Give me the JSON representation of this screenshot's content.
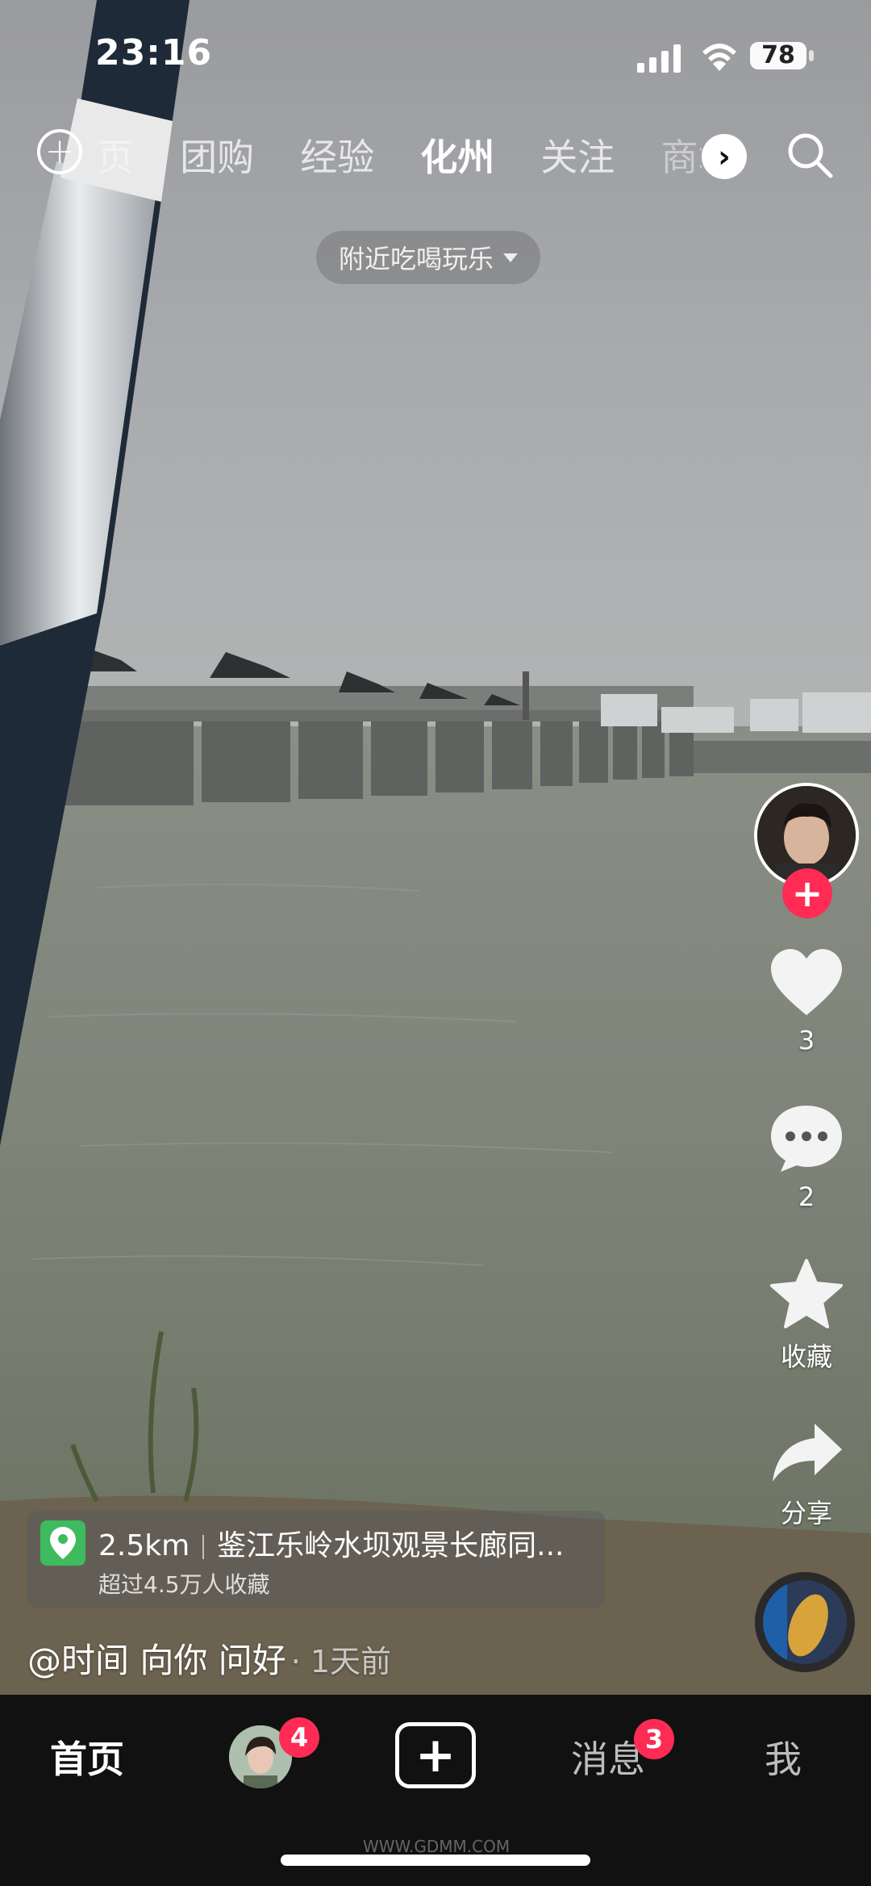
{
  "status_bar": {
    "time": "23:16",
    "battery": "78"
  },
  "top_nav": {
    "tabs": [
      {
        "label": "页",
        "state": "partial"
      },
      {
        "label": "团购",
        "state": "normal"
      },
      {
        "label": "经验",
        "state": "normal"
      },
      {
        "label": "化州",
        "state": "active"
      },
      {
        "label": "关注",
        "state": "normal"
      },
      {
        "label": "商城",
        "state": "partial"
      }
    ],
    "nearby_filter": "附近吃喝玩乐"
  },
  "rail": {
    "likes": "3",
    "comments": "2",
    "favorite_label": "收藏",
    "share_label": "分享"
  },
  "location": {
    "distance": "2.5km",
    "name": "鉴江乐岭水坝观景长廊同...",
    "saves": "超过4.5万人收藏"
  },
  "post": {
    "author": "@时间 向你 问好",
    "time": "· 1天前"
  },
  "bottom_bar": {
    "home": "首页",
    "friends_badge": "4",
    "messages": "消息",
    "messages_badge": "3",
    "me": "我"
  },
  "watermark": "WWW.GDMM.COM",
  "colors": {
    "accent": "#fe2c55",
    "location_green": "#3dbb5e",
    "bar_bg": "#111111"
  }
}
